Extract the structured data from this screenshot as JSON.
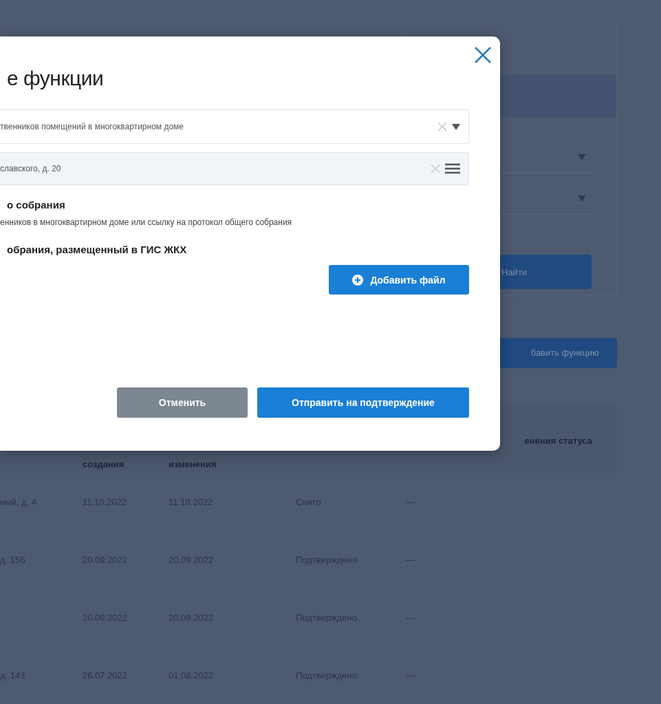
{
  "filter_panel": {
    "dropdowns": [
      {
        "kind": "select"
      },
      {
        "kind": "select"
      }
    ],
    "search_button": "Найти"
  },
  "add_function_button": "бавить функцию",
  "table": {
    "columns": [
      null,
      "создания",
      "изменения",
      null,
      "енения статуса"
    ],
    "rows": [
      {
        "cells": [
          "ный, д. 4",
          "11.10.2022",
          "11.10.2022",
          "Снято",
          "—"
        ]
      },
      {
        "cells": [
          "д. 15Б",
          "20.09.2022",
          "20.09.2022",
          "Подтверждено",
          "—"
        ]
      },
      {
        "cells": [
          null,
          "20.09.2022",
          "20.09.2022",
          "Подтверждено",
          "—"
        ]
      },
      {
        "cells": [
          "д. 143",
          "26.07.2022",
          "01.08.2022",
          "Подтверждено",
          "—"
        ]
      }
    ]
  },
  "modal": {
    "title": "е функции",
    "fields": [
      {
        "kind": "select",
        "value": "твенников помещений в многоквартирном доме"
      },
      {
        "kind": "list",
        "value": "славского, д. 20"
      }
    ],
    "section_title": "о собрания",
    "section_text": "енников в многоквартирном доме или ссылку на протокол общего собрания",
    "upload_title": "обрания, размещенный в ГИС ЖКХ",
    "add_file_button": "Добавить файл",
    "buttons": [
      {
        "kind": "secondary",
        "label": "Отменить"
      },
      {
        "kind": "primary",
        "label": "Отправить на подтверждение"
      }
    ]
  }
}
